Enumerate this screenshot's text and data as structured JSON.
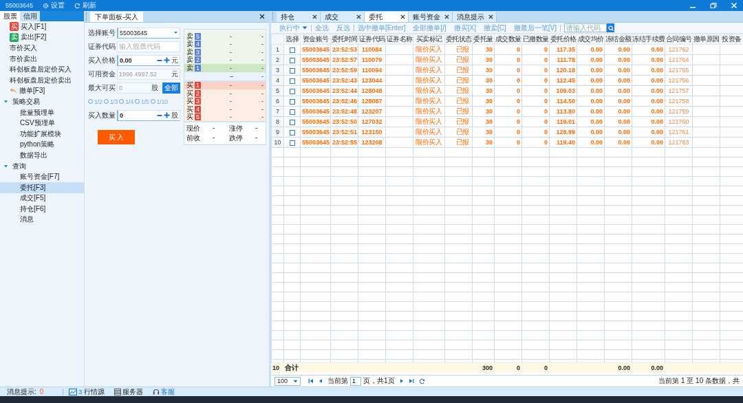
{
  "title_bar": {
    "account": "55003645",
    "settings": "设置",
    "refresh": "刷新"
  },
  "sidebar": {
    "tabs": [
      {
        "label": "股票",
        "selected": true
      },
      {
        "label": "信用",
        "selected": false
      }
    ],
    "items": [
      {
        "label": "买入[F1]",
        "kind": "buy",
        "badge": "买",
        "selected": false
      },
      {
        "label": "卖出[F2]",
        "kind": "sell",
        "badge": "卖",
        "selected": false
      },
      {
        "label": "市价买入",
        "kind": "plain",
        "selected": false
      },
      {
        "label": "市价卖出",
        "kind": "plain",
        "selected": false
      },
      {
        "label": "科创板盘后定价买入",
        "kind": "plain",
        "selected": false
      },
      {
        "label": "科创板盘后定价卖出",
        "kind": "plain",
        "selected": false
      },
      {
        "label": "撤单[F3]",
        "kind": "cancel",
        "selected": false
      },
      {
        "label": "策略交易",
        "kind": "group",
        "expanded": true,
        "selected": false,
        "children": [
          {
            "label": "批量预埋单",
            "selected": false
          },
          {
            "label": "CSV预埋单",
            "selected": false
          },
          {
            "label": "功能扩展模块",
            "selected": false
          },
          {
            "label": "python策略",
            "selected": false
          },
          {
            "label": "数据导出",
            "selected": false
          }
        ]
      },
      {
        "label": "查询",
        "kind": "group",
        "expanded": true,
        "selected": false,
        "children": [
          {
            "label": "账号资金[F7]",
            "selected": false
          },
          {
            "label": "委托[F3]",
            "selected": true
          },
          {
            "label": "成交[F5]",
            "selected": false
          },
          {
            "label": "持仓[F6]",
            "selected": false
          },
          {
            "label": "消息",
            "selected": false
          }
        ]
      }
    ]
  },
  "order_panel": {
    "tab": "下单面板-买入",
    "fields": [
      {
        "kind": "select",
        "label": "选择账号",
        "value": "55003645"
      },
      {
        "kind": "text",
        "label": "证券代码",
        "placeholder": "输入股票代码"
      },
      {
        "kind": "stepper",
        "label": "买入价格",
        "value": "0.00",
        "unit": "元"
      },
      {
        "kind": "readonly",
        "label": "可用资金",
        "value": "1996 4997.52",
        "unit": "元",
        "disabled": true
      },
      {
        "kind": "max",
        "label": "最大可买",
        "value": "0",
        "unit": "股",
        "button": "全部",
        "disabled": true
      },
      {
        "kind": "fractions",
        "options": [
          {
            "label": "1/2",
            "selected": false
          },
          {
            "label": "1/3",
            "selected": false
          },
          {
            "label": "1/4",
            "selected": false
          },
          {
            "label": "1/5",
            "selected": false
          },
          {
            "label": "1/10",
            "selected": false
          }
        ]
      },
      {
        "kind": "stepper",
        "label": "买入数量",
        "value": "0",
        "unit": "股"
      }
    ],
    "submit": "买 入",
    "order_book": {
      "asks": [
        {
          "side": "卖",
          "level": "5",
          "price": "-",
          "volume": "-",
          "highlighted": false
        },
        {
          "side": "卖",
          "level": "4",
          "price": "-",
          "volume": "-",
          "highlighted": false
        },
        {
          "side": "卖",
          "level": "3",
          "price": "-",
          "volume": "-",
          "highlighted": false
        },
        {
          "side": "卖",
          "level": "2",
          "price": "-",
          "volume": "-",
          "highlighted": false
        },
        {
          "side": "卖",
          "level": "1",
          "price": "-",
          "volume": "-",
          "highlighted": true
        }
      ],
      "middle": {
        "price": "–",
        "volume": "-"
      },
      "bids": [
        {
          "side": "买",
          "level": "1",
          "price": "-",
          "volume": "-",
          "highlighted": true
        },
        {
          "side": "买",
          "level": "2",
          "price": "-",
          "volume": "-",
          "highlighted": false
        },
        {
          "side": "买",
          "level": "3",
          "price": "-",
          "volume": "-",
          "highlighted": false
        },
        {
          "side": "买",
          "level": "4",
          "price": "-",
          "volume": "-",
          "highlighted": false
        },
        {
          "side": "买",
          "level": "5",
          "price": "-",
          "volume": "-",
          "highlighted": false
        }
      ],
      "summary": [
        {
          "label": "现价",
          "value": "-"
        },
        {
          "label": "涨停",
          "value": "-"
        },
        {
          "label": "前收",
          "value": "-"
        },
        {
          "label": "跌停",
          "value": "-"
        }
      ]
    }
  },
  "orders_panel": {
    "tabs": [
      {
        "label": "持仓",
        "selected": false
      },
      {
        "label": "成交",
        "selected": false
      },
      {
        "label": "委托",
        "selected": true
      },
      {
        "label": "账号资金",
        "selected": false
      },
      {
        "label": "消息提示",
        "selected": false
      }
    ],
    "toolbar": [
      {
        "kind": "dropdown",
        "label": "执行中"
      },
      {
        "kind": "sep"
      },
      {
        "kind": "button",
        "label": "全选"
      },
      {
        "kind": "button",
        "label": "反选"
      },
      {
        "kind": "sep"
      },
      {
        "kind": "button",
        "label": "选中撤单[Enter]"
      },
      {
        "kind": "button",
        "label": "全部撤单[/]"
      },
      {
        "kind": "button",
        "label": "撤买[X]"
      },
      {
        "kind": "button",
        "label": "撤卖[C]"
      },
      {
        "kind": "button",
        "label": "撤最后一笔[V]"
      },
      {
        "kind": "sep"
      },
      {
        "kind": "search",
        "placeholder": "请输入代码"
      }
    ],
    "columns": [
      {
        "label": "选择",
        "kind": "check"
      },
      {
        "label": "资金账号",
        "kind": "id"
      },
      {
        "label": "委托时间",
        "kind": "id"
      },
      {
        "label": "证券代码",
        "kind": "id"
      },
      {
        "label": "证券名称",
        "kind": "blank"
      },
      {
        "label": "买卖标记",
        "kind": "text"
      },
      {
        "label": "委托状态",
        "kind": "status"
      },
      {
        "label": "委托量",
        "kind": "number"
      },
      {
        "label": "成交数量",
        "kind": "number"
      },
      {
        "label": "已撤数量",
        "kind": "number"
      },
      {
        "label": "委托价格",
        "kind": "number"
      },
      {
        "label": "成交均价",
        "kind": "number"
      },
      {
        "label": "冻结金额",
        "kind": "number"
      },
      {
        "label": "冻结手续费",
        "kind": "number"
      },
      {
        "label": "合同编号",
        "kind": "ref"
      },
      {
        "label": "撤单原因",
        "kind": "blank"
      },
      {
        "label": "投资备",
        "kind": "blank"
      }
    ],
    "rows": [
      {
        "no": "1",
        "checked": false,
        "cells": [
          "",
          "55003645",
          "23:52:53",
          "110084",
          "",
          "限价买入",
          "已报",
          "30",
          "0",
          "0",
          "117.35",
          "0.00",
          "0.00",
          "0.00",
          "121762",
          "",
          ""
        ]
      },
      {
        "no": "2",
        "checked": false,
        "cells": [
          "",
          "55003645",
          "23:52:57",
          "110079",
          "",
          "限价买入",
          "已报",
          "30",
          "0",
          "0",
          "111.78",
          "0.00",
          "0.00",
          "0.00",
          "121764",
          "",
          ""
        ]
      },
      {
        "no": "3",
        "checked": false,
        "cells": [
          "",
          "55003645",
          "23:52:59",
          "110094",
          "",
          "限价买入",
          "已报",
          "30",
          "0",
          "0",
          "120.18",
          "0.00",
          "0.00",
          "0.00",
          "121765",
          "",
          ""
        ]
      },
      {
        "no": "4",
        "checked": false,
        "cells": [
          "",
          "55003645",
          "23:52:43",
          "123044",
          "",
          "限价买入",
          "已报",
          "30",
          "0",
          "0",
          "112.45",
          "0.00",
          "0.00",
          "0.00",
          "121756",
          "",
          ""
        ]
      },
      {
        "no": "5",
        "checked": false,
        "cells": [
          "",
          "55003645",
          "23:52:44",
          "128048",
          "",
          "限价买入",
          "已报",
          "30",
          "0",
          "0",
          "109.03",
          "0.00",
          "0.00",
          "0.00",
          "121757",
          "",
          ""
        ]
      },
      {
        "no": "6",
        "checked": false,
        "cells": [
          "",
          "55003645",
          "23:52:46",
          "128087",
          "",
          "限价买入",
          "已报",
          "30",
          "0",
          "0",
          "114.50",
          "0.00",
          "0.00",
          "0.00",
          "121758",
          "",
          ""
        ]
      },
      {
        "no": "7",
        "checked": false,
        "cells": [
          "",
          "55003645",
          "23:52:48",
          "123207",
          "",
          "限价买入",
          "已报",
          "30",
          "0",
          "0",
          "113.80",
          "0.00",
          "0.00",
          "0.00",
          "121759",
          "",
          ""
        ]
      },
      {
        "no": "8",
        "checked": false,
        "cells": [
          "",
          "55003645",
          "23:52:50",
          "127032",
          "",
          "限价买入",
          "已报",
          "30",
          "0",
          "0",
          "119.01",
          "0.00",
          "0.00",
          "0.00",
          "121760",
          "",
          ""
        ]
      },
      {
        "no": "9",
        "checked": false,
        "cells": [
          "",
          "55003645",
          "23:52:51",
          "123150",
          "",
          "限价买入",
          "已报",
          "30",
          "0",
          "0",
          "128.99",
          "0.00",
          "0.00",
          "0.00",
          "121761",
          "",
          ""
        ]
      },
      {
        "no": "10",
        "checked": false,
        "cells": [
          "",
          "55003645",
          "23:52:55",
          "123208",
          "",
          "限价买入",
          "已报",
          "30",
          "0",
          "0",
          "119.40",
          "0.00",
          "0.00",
          "0.00",
          "121763",
          "",
          ""
        ]
      }
    ],
    "totals": {
      "no": "10",
      "label": "合计",
      "qty": "300",
      "filled": "0",
      "cancelled": "0",
      "frozen": "0.00",
      "fee": "0.00"
    },
    "pager": {
      "page_size": "100",
      "prefix": "当前第",
      "page": "1",
      "suffix": "页，共1页",
      "range": "当前第 1 至 10 条数据，共"
    }
  },
  "status_bar": {
    "message_label": "消息提示:",
    "message_count": "0",
    "items": [
      {
        "kind": "quotes",
        "label": "行情源",
        "badge": "3"
      },
      {
        "kind": "server",
        "label": "服务器"
      },
      {
        "kind": "support",
        "label": "客服"
      }
    ]
  }
}
